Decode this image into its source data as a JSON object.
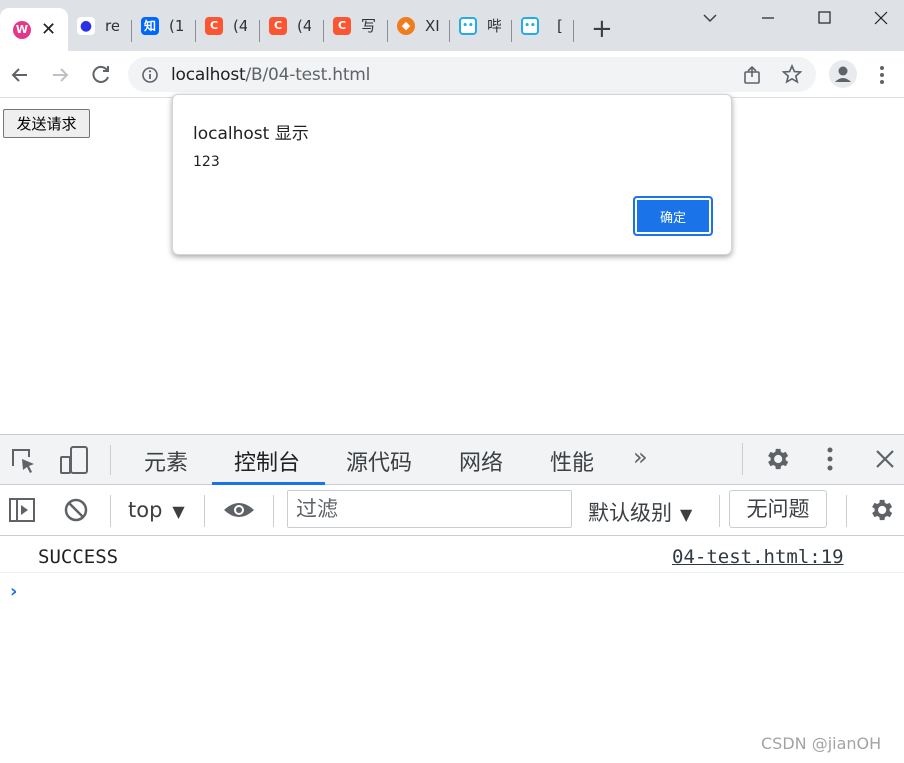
{
  "browser": {
    "tabs": [
      {
        "label": "",
        "icon": "wiki-icon",
        "color": "#e5368a",
        "glyph": "W"
      },
      {
        "label": "re",
        "icon": "baidu-paw-icon",
        "color": "#2932e1",
        "glyph": "🐾"
      },
      {
        "label": "(1",
        "icon": "zhihu-icon",
        "color": "#0066ff",
        "glyph": "知"
      },
      {
        "label": "(4",
        "icon": "csdn-icon",
        "color": "#fc5531",
        "glyph": "C"
      },
      {
        "label": "(4",
        "icon": "csdn-icon",
        "color": "#fc5531",
        "glyph": "C"
      },
      {
        "label": "写",
        "icon": "csdn-icon",
        "color": "#fc5531",
        "glyph": "C"
      },
      {
        "label": "XI",
        "icon": "fox-icon",
        "color": "#f07c1e",
        "glyph": ""
      },
      {
        "label": "哔",
        "icon": "bilibili-icon",
        "color": "#23ade5",
        "glyph": ""
      },
      {
        "label": "[",
        "icon": "bilibili-icon",
        "color": "#23ade5",
        "glyph": ""
      }
    ],
    "new_tab": "+",
    "url_host": "localhost",
    "url_path": "/B/04-test.html"
  },
  "page": {
    "button_label": "发送请求"
  },
  "dialog": {
    "title": "localhost 显示",
    "message": "123",
    "ok_label": "确定"
  },
  "devtools": {
    "tabs": [
      "元素",
      "控制台",
      "源代码",
      "网络",
      "性能"
    ],
    "more": "»",
    "context": "top",
    "filter_placeholder": "过滤",
    "level": "默认级别",
    "issues": "无问题",
    "log": {
      "message": "SUCCESS",
      "source": "04-test.html:19"
    },
    "prompt": "›"
  },
  "watermark": "CSDN @jianOH"
}
